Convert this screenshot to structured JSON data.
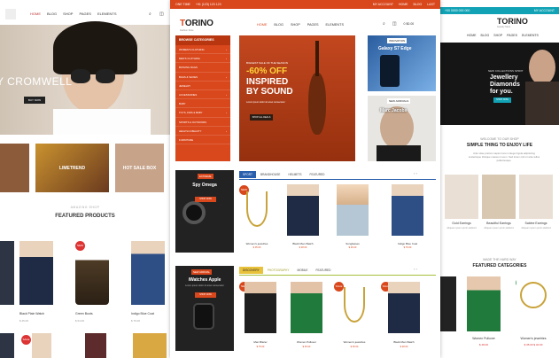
{
  "left": {
    "nav": [
      "HOME",
      "BLOG",
      "SHOP",
      "PAGES",
      "ELEMENTS"
    ],
    "hero_text": "Y CROMWELL",
    "hero_button": "BUY NOW",
    "tiles": [
      "",
      "LIMETREND",
      "HOT SALE BOX"
    ],
    "section_eyebrow": "AMAZING SHOP",
    "section_title": "FEATURED PRODUCTS",
    "products": [
      {
        "name": "Black Plain Watch",
        "price": "$ 45.00"
      },
      {
        "name": "Green Boots",
        "price": "$ 64.00"
      },
      {
        "name": "Indigo Blue Coat",
        "price": "$ 76.00"
      }
    ],
    "badges": [
      "NEW",
      "NEW",
      "SALE"
    ]
  },
  "middle": {
    "topbar_left": "ONE TIME",
    "topbar_phone": "+91 (123) 123 123",
    "topbar_right": [
      "MY ACCOUNT",
      "HOME",
      "BLOG",
      "LAST"
    ],
    "logo_main": "ORINO",
    "logo_letter": "T",
    "logo_sub": "Fashion Store",
    "nav": [
      "HOME",
      "BLOG",
      "SHOP",
      "PAGES",
      "ELEMENTS"
    ],
    "cart": "0  $0.00",
    "categories_header": "BROWSE CATEGORIES",
    "categories": [
      "WOMEN'S CLOTHING",
      "MEN'S CLOTHING",
      "BATHING RAGS",
      "BAGS & SHOES",
      "JEWELRY",
      "ACCESSORIES",
      "BABY",
      "TOYS, KIDS & BABY",
      "SPORTS & OUTDOORS",
      "HEALTH & BEAUTY",
      "FURNITURE"
    ],
    "hero": {
      "line1": "BIGGEST SALE OF THE SEASON",
      "line2": "-60% OFF",
      "line3": "INSPIRED BY SOUND",
      "line4": "Lorem ipsum dolor sit amet consectetur",
      "button": "SHOP ALL DEALS"
    },
    "side1_label": "INNOVATION",
    "side1_title": "Galaxy S7 Edge",
    "side2_label": "NEW ARRIVALS",
    "side2_title": "Marc Jacobs",
    "block1_label": "EXTREME",
    "block1_title": "Spy Omega",
    "block1_button": "SHOP NOW",
    "block2_label": "NEW ARRIVAL",
    "block2_title": "iWatches Apple",
    "block2_text": "Lorem ipsum dolor sit amet consectetur",
    "block2_button": "SHOP NOW",
    "tabs1": [
      "SPORT",
      "BRANDHOUSE",
      "HELMETS",
      "FEATURED"
    ],
    "tabs2": [
      "DISCOVERY",
      "PHOTOGRAPHY",
      "MOBILE",
      "FEATURED"
    ],
    "row1": [
      {
        "name": "Women's jewelries",
        "price": "$ 35.00"
      },
      {
        "name": "Black Man Watch",
        "price": "$ 48.00"
      },
      {
        "name": "Sunglasses",
        "price": "$ 26.00"
      },
      {
        "name": "Indigo Blue Coat",
        "price": "$ 76.00"
      }
    ],
    "row2": [
      {
        "name": "Man Blazer",
        "price": "$ 75.00"
      },
      {
        "name": "Women Pullover",
        "price": "$ 45.00"
      },
      {
        "name": "Women's jewelries",
        "price": "$ 35.00"
      },
      {
        "name": "Black Man Watch",
        "price": "$ 48.00"
      }
    ],
    "badges": [
      "NEW",
      "NEW",
      "SALE",
      "SALE"
    ]
  },
  "right": {
    "topbar_phone": "+00 0000 000 000",
    "topbar_right": "MY ACCOUNT",
    "logo": "TORINO",
    "logo_sub": "Jewelry Store",
    "nav": [
      "HOME",
      "BLOG",
      "SHOP",
      "PAGES",
      "ELEMENTS"
    ],
    "hero": {
      "t1": "NEW COLLECTIONS SPIRIT",
      "t2": "Jewellery Diamonds for you.",
      "button": "SHOP NOW"
    },
    "welcome1": "WELCOME TO OUR SHOP",
    "welcome2": "SIMPLE THING TO ENJOY LIFE",
    "welcome3": "Ante vitae pretium sapien lorem integer ligula adipisicing scelerisque tristique massa mi eum. Sed lorem nisl mi ante tellus pellentesque.",
    "jewels": [
      {
        "name": "Gold Earrings",
        "text": "Aliquam ipsum proin eleifend"
      },
      {
        "name": "Beautiful Earrings",
        "text": "Aliquam ipsum proin eleifend"
      },
      {
        "name": "Sabine Earrings",
        "text": "Aliquam ipsum proin eleifend"
      }
    ],
    "feat1": "MADE THE HARD WAY",
    "feat2": "FEATURED CATEGORIES",
    "fprods": [
      {
        "name": "Women Pullover",
        "price": "$ 48.00"
      },
      {
        "name": "Women's jewelries",
        "price": "$ 35.00 $ 40.00"
      }
    ],
    "badges": [
      "NEW",
      "SALE"
    ]
  },
  "colors": {
    "orange": "#d9471c",
    "teal": "#11a3b5",
    "blue": "#2a5fae",
    "lime": "#a3c23b"
  }
}
